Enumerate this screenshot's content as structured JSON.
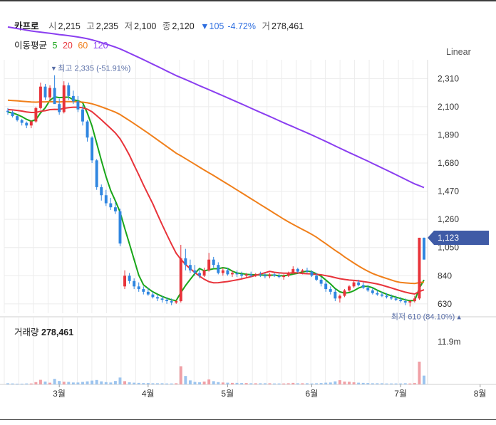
{
  "header": {
    "name": "카프로",
    "open_label": "시",
    "open": "2,215",
    "high_label": "고",
    "high": "2,235",
    "low_label": "저",
    "low": "2,100",
    "close_label": "종",
    "close": "2,120",
    "change": "▼105",
    "change_pct": "-4.72%",
    "volume_label": "거",
    "volume": "278,461"
  },
  "moving_average": {
    "label": "이동평균",
    "periods": [
      {
        "label": "5",
        "color": "#19a619"
      },
      {
        "label": "20",
        "color": "#e8333a"
      },
      {
        "label": "60",
        "color": "#f07f1a"
      },
      {
        "label": "120",
        "color": "#8a3ef0"
      }
    ]
  },
  "scale_label": "Linear",
  "volume_panel": {
    "label": "거래량",
    "value": "278,461",
    "max_label": "11.9m"
  },
  "colors": {
    "up": "#e8333a",
    "down": "#2f86e0",
    "up_volume": "#f0a0a6",
    "down_volume": "#9cc4ee",
    "price_tag": "#3f5ba6"
  },
  "chart_data": {
    "type": "candlestick",
    "y_ticks": [
      "2,310",
      "2,100",
      "1,890",
      "1,680",
      "1,470",
      "1,260",
      "1,050",
      "840",
      "630"
    ],
    "y_tick_values": [
      2310,
      2100,
      1890,
      1680,
      1470,
      1260,
      1050,
      840,
      630
    ],
    "ylim": [
      560,
      2450
    ],
    "x_ticks": [
      "3월",
      "4월",
      "5월",
      "6월",
      "7월",
      "8월"
    ],
    "x_tick_index": [
      11,
      30,
      47,
      65,
      84,
      101
    ],
    "last_price_label": "1,123",
    "last_price": 1123,
    "max_annotation": "최고 2,335 (-51.91%)",
    "max_value": 2335,
    "max_index": 10,
    "min_annotation": "최저 610 (84.10%)",
    "min_value": 610,
    "min_index": 96,
    "volume_max": 11900000,
    "candles": [
      [
        2070,
        2090,
        2040,
        2060
      ],
      [
        2060,
        2070,
        2020,
        2030
      ],
      [
        2030,
        2040,
        1990,
        2000
      ],
      [
        2000,
        2010,
        1960,
        1980
      ],
      [
        1980,
        1990,
        1940,
        1960
      ],
      [
        1960,
        2000,
        1940,
        1990
      ],
      [
        1990,
        2100,
        1980,
        2090
      ],
      [
        2090,
        2280,
        2080,
        2250
      ],
      [
        2250,
        2270,
        2150,
        2170
      ],
      [
        2170,
        2260,
        2150,
        2240
      ],
      [
        2240,
        2335,
        2200,
        2120
      ],
      [
        2120,
        2160,
        2040,
        2060
      ],
      [
        2060,
        2290,
        2050,
        2260
      ],
      [
        2260,
        2280,
        2150,
        2180
      ],
      [
        2180,
        2220,
        2120,
        2140
      ],
      [
        2140,
        2180,
        2060,
        2080
      ],
      [
        2080,
        2110,
        1960,
        1990
      ],
      [
        1990,
        2000,
        1840,
        1870
      ],
      [
        1870,
        1880,
        1680,
        1700
      ],
      [
        1700,
        1710,
        1480,
        1500
      ],
      [
        1500,
        1520,
        1400,
        1440
      ],
      [
        1440,
        1480,
        1360,
        1380
      ],
      [
        1380,
        1420,
        1330,
        1350
      ],
      [
        1350,
        1390,
        1300,
        1320
      ],
      [
        1320,
        1340,
        1060,
        1080
      ],
      [
        760,
        880,
        740,
        840
      ],
      [
        840,
        860,
        780,
        800
      ],
      [
        800,
        820,
        740,
        760
      ],
      [
        760,
        790,
        720,
        740
      ],
      [
        740,
        760,
        700,
        720
      ],
      [
        720,
        750,
        690,
        700
      ],
      [
        700,
        720,
        670,
        680
      ],
      [
        680,
        700,
        650,
        670
      ],
      [
        670,
        690,
        640,
        660
      ],
      [
        660,
        680,
        630,
        650
      ],
      [
        650,
        670,
        620,
        640
      ],
      [
        640,
        660,
        630,
        650
      ],
      [
        650,
        1070,
        640,
        970
      ],
      [
        970,
        1040,
        880,
        920
      ],
      [
        920,
        960,
        860,
        880
      ],
      [
        880,
        920,
        840,
        860
      ],
      [
        860,
        890,
        820,
        840
      ],
      [
        840,
        900,
        830,
        880
      ],
      [
        880,
        1010,
        870,
        960
      ],
      [
        960,
        980,
        900,
        920
      ],
      [
        920,
        940,
        850,
        860
      ],
      [
        860,
        900,
        840,
        880
      ],
      [
        880,
        900,
        840,
        850
      ],
      [
        850,
        880,
        830,
        860
      ],
      [
        860,
        880,
        830,
        850
      ],
      [
        850,
        870,
        820,
        840
      ],
      [
        840,
        860,
        820,
        850
      ],
      [
        850,
        870,
        830,
        840
      ],
      [
        840,
        860,
        830,
        850
      ],
      [
        850,
        870,
        830,
        845
      ],
      [
        845,
        860,
        820,
        835
      ],
      [
        835,
        860,
        820,
        850
      ],
      [
        850,
        860,
        830,
        840
      ],
      [
        840,
        860,
        820,
        830
      ],
      [
        830,
        850,
        810,
        840
      ],
      [
        840,
        870,
        830,
        860
      ],
      [
        860,
        910,
        850,
        890
      ],
      [
        890,
        900,
        860,
        870
      ],
      [
        870,
        890,
        850,
        880
      ],
      [
        880,
        900,
        860,
        870
      ],
      [
        870,
        880,
        830,
        840
      ],
      [
        840,
        860,
        800,
        810
      ],
      [
        810,
        830,
        760,
        780
      ],
      [
        780,
        800,
        720,
        740
      ],
      [
        740,
        760,
        700,
        720
      ],
      [
        720,
        740,
        650,
        670
      ],
      [
        670,
        700,
        640,
        690
      ],
      [
        690,
        740,
        680,
        730
      ],
      [
        730,
        770,
        720,
        760
      ],
      [
        760,
        800,
        750,
        790
      ],
      [
        790,
        810,
        760,
        770
      ],
      [
        770,
        790,
        740,
        750
      ],
      [
        750,
        770,
        720,
        730
      ],
      [
        730,
        750,
        700,
        710
      ],
      [
        710,
        730,
        690,
        700
      ],
      [
        700,
        720,
        680,
        690
      ],
      [
        690,
        710,
        670,
        680
      ],
      [
        680,
        700,
        660,
        670
      ],
      [
        670,
        690,
        650,
        660
      ],
      [
        660,
        680,
        640,
        650
      ],
      [
        650,
        670,
        620,
        640
      ],
      [
        640,
        660,
        610,
        650
      ],
      [
        650,
        690,
        640,
        670
      ],
      [
        670,
        1123,
        660,
        1123
      ],
      [
        1123,
        1125,
        960,
        960
      ]
    ],
    "volumes": [
      0.6,
      0.5,
      0.4,
      0.4,
      0.5,
      0.5,
      1.2,
      2.4,
      1.5,
      0.9,
      2.9,
      1.8,
      1.4,
      1.3,
      1.0,
      1.0,
      1.3,
      1.6,
      2.0,
      2.3,
      1.6,
      1.2,
      1.0,
      1.8,
      3.6,
      1.7,
      1.1,
      0.9,
      0.8,
      0.7,
      0.7,
      0.6,
      0.6,
      0.6,
      0.5,
      0.5,
      0.6,
      9.5,
      4.4,
      2.1,
      1.3,
      1.1,
      1.5,
      2.6,
      1.7,
      1.2,
      1.0,
      0.9,
      0.8,
      0.8,
      0.7,
      0.7,
      0.6,
      0.6,
      0.6,
      0.6,
      0.6,
      0.5,
      0.5,
      0.5,
      0.6,
      0.8,
      0.6,
      0.6,
      0.6,
      0.5,
      0.6,
      0.7,
      0.9,
      1.0,
      1.6,
      2.2,
      1.5,
      1.4,
      1.1,
      0.9,
      0.8,
      0.7,
      0.6,
      0.6,
      0.6,
      0.5,
      0.5,
      0.5,
      0.5,
      0.6,
      0.5,
      0.7,
      11.9,
      4.6
    ]
  }
}
